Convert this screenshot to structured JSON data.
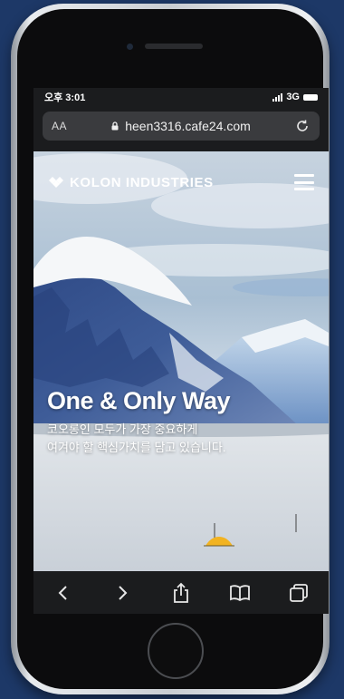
{
  "status_bar": {
    "time": "오후 3:01",
    "network": "3G"
  },
  "browser": {
    "text_size_label": "AA",
    "url": "heen3316.cafe24.com"
  },
  "site": {
    "brand_name": "KOLON INDUSTRIES",
    "hero_title": "One & Only Way",
    "hero_subtitle_line1": "코오롱인 모두가 가장 중요하게",
    "hero_subtitle_line2": "여겨야 할 핵심가치를 담고 있습니다."
  },
  "toolbar": {
    "items": [
      "back-icon",
      "forward-icon",
      "share-icon",
      "bookmarks-icon",
      "tabs-icon"
    ]
  },
  "colors": {
    "page_background": "#1d3867",
    "browser_chrome": "#1b1c1e",
    "url_field": "#3a3b3e",
    "tent": "#f2b321"
  }
}
